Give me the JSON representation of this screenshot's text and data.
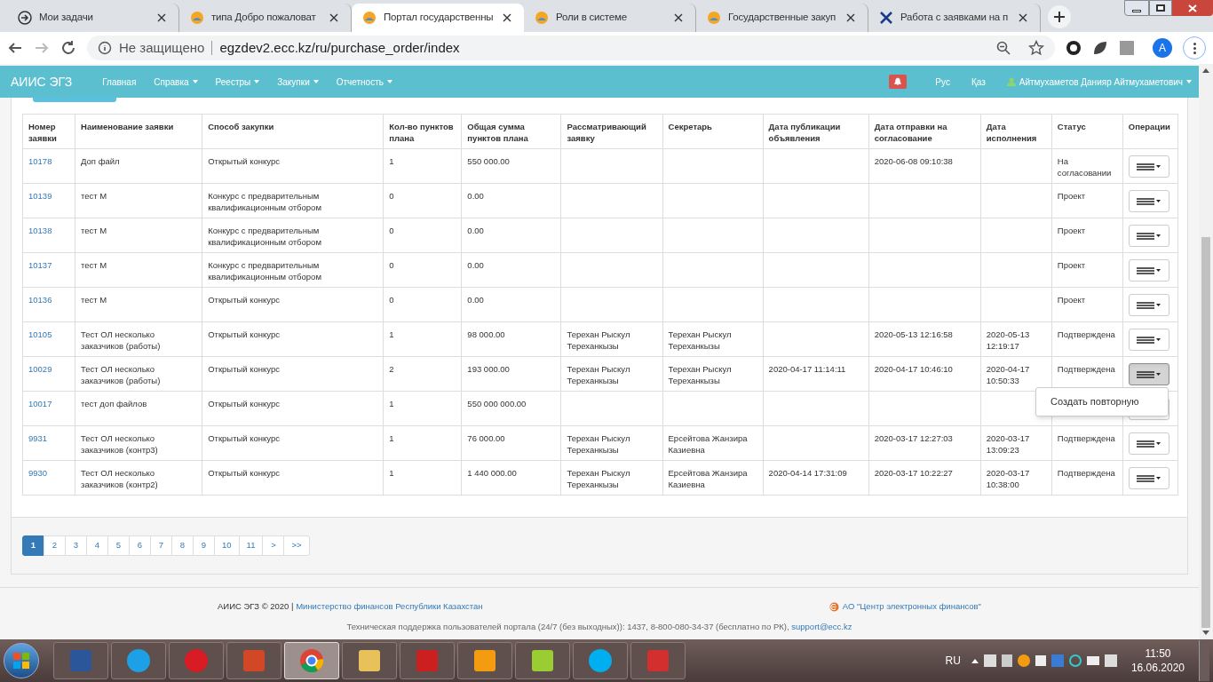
{
  "browser": {
    "tabs": [
      {
        "title": "Мои задачи",
        "kind": "arrow",
        "selected": false
      },
      {
        "title": "типа Добро пожаловат",
        "kind": "sun",
        "selected": false
      },
      {
        "title": "Портал государственны",
        "kind": "sun",
        "selected": true
      },
      {
        "title": "Роли в системе",
        "kind": "sun",
        "selected": false
      },
      {
        "title": "Государственные закуп",
        "kind": "sun",
        "selected": false
      },
      {
        "title": "Работа с заявками на п",
        "kind": "tools",
        "selected": false
      }
    ],
    "security": "Не защищено",
    "url": "egzdev2.ecc.kz/ru/purchase_order/index",
    "profile": "A"
  },
  "navbar": {
    "brand": "АИИС ЭГЗ",
    "items": [
      {
        "label": "Главная",
        "dropdown": false
      },
      {
        "label": "Справка",
        "dropdown": true
      },
      {
        "label": "Реестры",
        "dropdown": true
      },
      {
        "label": "Закупки",
        "dropdown": true
      },
      {
        "label": "Отчетность",
        "dropdown": true
      }
    ],
    "languages": [
      "Рус",
      "Қаз"
    ],
    "user": "Айтмухаметов Данияр Айтмухаметович"
  },
  "table": {
    "columns": [
      "Номер заявки",
      "Наименование заявки",
      "Способ закупки",
      "Кол-во пунктов плана",
      "Общая сумма пунктов плана",
      "Рассматривающий заявку",
      "Секретарь",
      "Дата публикации объявления",
      "Дата отправки на согласование",
      "Дата исполнения",
      "Статус",
      "Операции"
    ],
    "rows": [
      {
        "cells": [
          "10178",
          "Доп файл",
          "Открытый конкурс",
          "1",
          "550 000.00",
          "",
          "",
          "",
          "2020-06-08 09:10:38",
          "",
          "На согласовании"
        ],
        "menu_open": false
      },
      {
        "cells": [
          "10139",
          "тест М",
          "Конкурс с предварительным квалификационным отбором",
          "0",
          "0.00",
          "",
          "",
          "",
          "",
          "",
          "Проект"
        ],
        "menu_open": false
      },
      {
        "cells": [
          "10138",
          "тест М",
          "Конкурс с предварительным квалификационным отбором",
          "0",
          "0.00",
          "",
          "",
          "",
          "",
          "",
          "Проект"
        ],
        "menu_open": false
      },
      {
        "cells": [
          "10137",
          "тест М",
          "Конкурс с предварительным квалификационным отбором",
          "0",
          "0.00",
          "",
          "",
          "",
          "",
          "",
          "Проект"
        ],
        "menu_open": false
      },
      {
        "cells": [
          "10136",
          "тест М",
          "Открытый конкурс",
          "0",
          "0.00",
          "",
          "",
          "",
          "",
          "",
          "Проект"
        ],
        "menu_open": false
      },
      {
        "cells": [
          "10105",
          "Тест ОЛ несколько заказчиков (работы)",
          "Открытый конкурс",
          "1",
          "98 000.00",
          "Терехан Рыскул Тереханкызы",
          "Терехан Рыскул Тереханкызы",
          "",
          "2020-05-13 12:16:58",
          "2020-05-13 12:19:17",
          "Подтверждена"
        ],
        "menu_open": false
      },
      {
        "cells": [
          "10029",
          "Тест ОЛ несколько заказчиков (работы)",
          "Открытый конкурс",
          "2",
          "193 000.00",
          "Терехан Рыскул Тереханкызы",
          "Терехан Рыскул Тереханкызы",
          "2020-04-17 11:14:11",
          "2020-04-17 10:46:10",
          "2020-04-17 10:50:33",
          "Подтверждена"
        ],
        "menu_open": true
      },
      {
        "cells": [
          "10017",
          "тест доп файлов",
          "Открытый конкурс",
          "1",
          "550 000 000.00",
          "",
          "",
          "",
          "",
          "",
          ""
        ],
        "menu_open": false
      },
      {
        "cells": [
          "9931",
          "Тест ОЛ несколько заказчиков (контр3)",
          "Открытый конкурс",
          "1",
          "76 000.00",
          "Терехан Рыскул Тереханкызы",
          "Ерсейтова Жанзира Казиевна",
          "",
          "2020-03-17 12:27:03",
          "2020-03-17 13:09:23",
          "Подтверждена"
        ],
        "menu_open": false
      },
      {
        "cells": [
          "9930",
          "Тест ОЛ несколько заказчиков (контр2)",
          "Открытый конкурс",
          "1",
          "1 440 000.00",
          "Терехан Рыскул Тереханкызы",
          "Ерсейтова Жанзира Казиевна",
          "2020-04-14 17:31:09",
          "2020-03-17 10:22:27",
          "2020-03-17 10:38:00",
          "Подтверждена"
        ],
        "menu_open": false
      }
    ],
    "row_menu": [
      "Создать повторную"
    ]
  },
  "pagination": [
    {
      "label": "1",
      "selected": true
    },
    {
      "label": "2",
      "selected": false
    },
    {
      "label": "3",
      "selected": false
    },
    {
      "label": "4",
      "selected": false
    },
    {
      "label": "5",
      "selected": false
    },
    {
      "label": "6",
      "selected": false
    },
    {
      "label": "7",
      "selected": false
    },
    {
      "label": "8",
      "selected": false
    },
    {
      "label": "9",
      "selected": false
    },
    {
      "label": "10",
      "selected": false
    },
    {
      "label": "11",
      "selected": false
    },
    {
      "label": ">",
      "selected": false
    },
    {
      "label": ">>",
      "selected": false
    }
  ],
  "footer": {
    "copyright": "АИИС ЭГЗ © 2020 |",
    "ministry": "Министерство финансов Республики Казахстан",
    "company": "АО \"Центр электронных финансов\"",
    "support": "Техническая поддержка пользователей портала (24/7 (без выходных)): 1437, 8-800-080-34-37 (бесплатно по РК),",
    "email": "support@ecc.kz"
  },
  "taskbar": {
    "apps": [
      {
        "kind": "word",
        "active": false
      },
      {
        "kind": "ie",
        "active": false
      },
      {
        "kind": "opera",
        "active": false
      },
      {
        "kind": "powerpoint",
        "active": false
      },
      {
        "kind": "chrome",
        "active": true
      },
      {
        "kind": "explorer",
        "active": false
      },
      {
        "kind": "pdf",
        "active": false
      },
      {
        "kind": "player",
        "active": false
      },
      {
        "kind": "notes",
        "active": false
      },
      {
        "kind": "skype",
        "active": false
      },
      {
        "kind": "shield",
        "active": false
      }
    ],
    "lang": "RU",
    "time": "11:50",
    "date": "16.06.2020"
  }
}
